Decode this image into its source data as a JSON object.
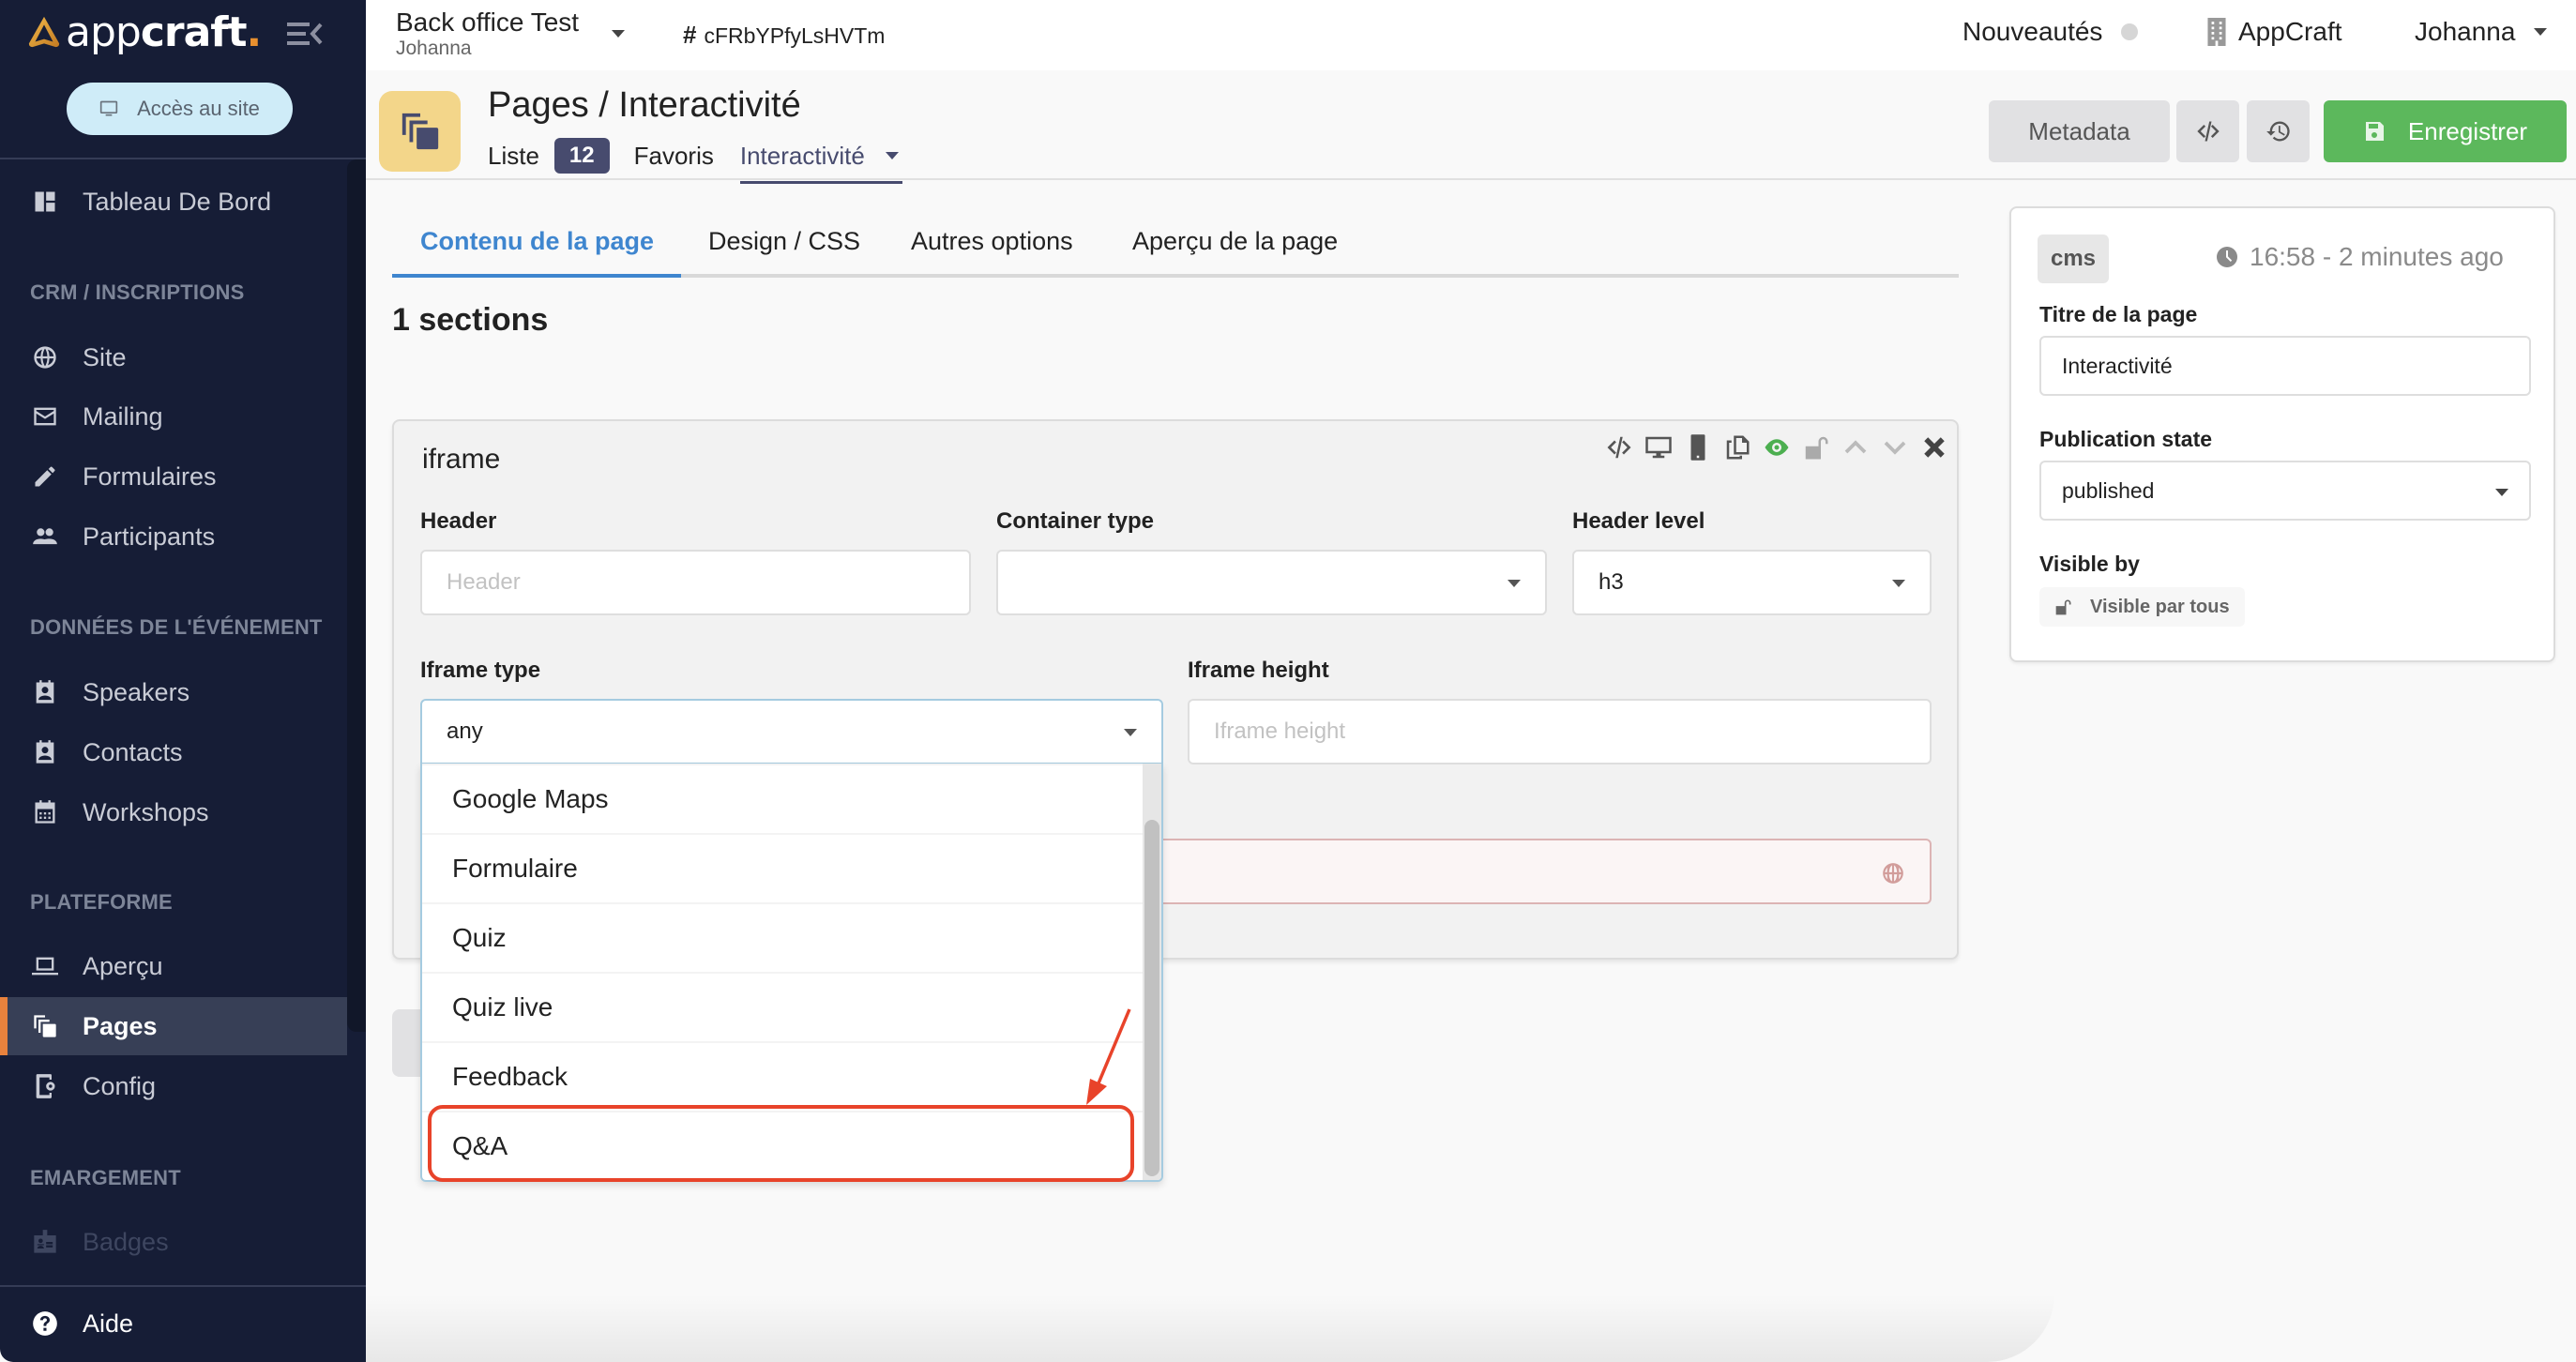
{
  "sidebar": {
    "logo": {
      "light": "app",
      "bold": "craft",
      "dot": "."
    },
    "site_button": "Accès au site",
    "top_item": {
      "label": "Tableau De Bord",
      "icon": "dashboard-icon"
    },
    "sections": [
      {
        "title": "CRM / INSCRIPTIONS",
        "items": [
          {
            "label": "Site",
            "icon": "globe-icon"
          },
          {
            "label": "Mailing",
            "icon": "mail-icon"
          },
          {
            "label": "Formulaires",
            "icon": "pencil-icon"
          },
          {
            "label": "Participants",
            "icon": "people-icon"
          }
        ]
      },
      {
        "title": "DONNÉES DE L'ÉVÉNEMENT",
        "items": [
          {
            "label": "Speakers",
            "icon": "contact-card-icon"
          },
          {
            "label": "Contacts",
            "icon": "contact-card-icon"
          },
          {
            "label": "Workshops",
            "icon": "calendar-icon"
          }
        ]
      },
      {
        "title": "PLATEFORME",
        "items": [
          {
            "label": "Aperçu",
            "icon": "laptop-icon"
          },
          {
            "label": "Pages",
            "icon": "pages-icon",
            "active": true
          },
          {
            "label": "Config",
            "icon": "device-settings-icon"
          }
        ]
      },
      {
        "title": "EMARGEMENT",
        "items": [
          {
            "label": "Badges",
            "icon": "badge-icon",
            "disabled": true
          }
        ]
      }
    ],
    "help": {
      "label": "Aide",
      "icon": "help-icon"
    }
  },
  "topbar": {
    "project_name": "Back office Test",
    "project_user": "Johanna",
    "hash_symbol": "#",
    "project_id": "cFRbYPfyLsHVTm",
    "news_label": "Nouveautés",
    "org_label": "AppCraft",
    "user_label": "Johanna"
  },
  "header": {
    "title": "Pages / Interactivité",
    "nav": {
      "list_label": "Liste",
      "list_count": "12",
      "favorites_label": "Favoris",
      "current_label": "Interactivité"
    },
    "buttons": {
      "metadata": "Metadata",
      "code": "code-icon",
      "history": "history-icon",
      "save": "Enregistrer"
    }
  },
  "tabs": [
    {
      "label": "Contenu de la page",
      "active": true
    },
    {
      "label": "Design / CSS"
    },
    {
      "label": "Autres options"
    },
    {
      "label": "Aperçu de la page"
    }
  ],
  "sections_count": "1 sections",
  "section_card": {
    "title": "iframe",
    "tools": [
      "code-icon",
      "desktop-icon",
      "mobile-icon",
      "copy-icon",
      "eye-icon",
      "unlock-icon",
      "chevron-up-icon",
      "chevron-down-icon",
      "close-icon"
    ],
    "fields": {
      "header": {
        "label": "Header",
        "placeholder": "Header",
        "value": ""
      },
      "container_type": {
        "label": "Container type",
        "value": ""
      },
      "header_level": {
        "label": "Header level",
        "value": "h3"
      },
      "iframe_type": {
        "label": "Iframe type",
        "value": "any"
      },
      "iframe_height": {
        "label": "Iframe height",
        "placeholder": "Iframe height",
        "value": ""
      },
      "url": {
        "value": ""
      }
    }
  },
  "iframe_type_dropdown": {
    "options": [
      "Google Maps",
      "Formulaire",
      "Quiz",
      "Quiz live",
      "Feedback",
      "Q&A"
    ],
    "highlighted": "Q&A"
  },
  "right_panel": {
    "badge": "cms",
    "timestamp": "16:58 - 2 minutes ago",
    "page_title_label": "Titre de la page",
    "page_title_value": "Interactivité",
    "publication_label": "Publication state",
    "publication_value": "published",
    "visible_label": "Visible by",
    "visible_value": "Visible par tous"
  },
  "colors": {
    "sidebar_bg": "#161d36",
    "accent_orange": "#e8823d",
    "tab_active": "#3f86cf",
    "save_green": "#5cb85c",
    "badge_purple": "#474b6e",
    "annotation_red": "#e8432a"
  }
}
